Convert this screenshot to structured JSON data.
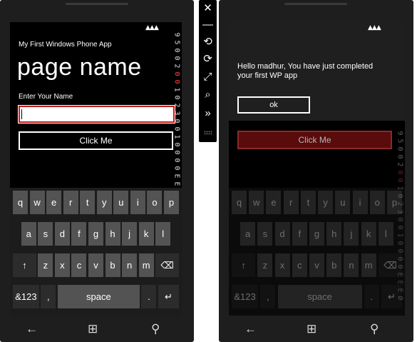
{
  "left_phone": {
    "status": {
      "signal": "▲▲▲"
    },
    "side_counter": [
      "9",
      "5",
      "0",
      "0",
      "2",
      "0",
      "0",
      "1",
      "0",
      "2",
      "3",
      "0",
      "0",
      "1",
      "0",
      "0",
      "0",
      "0",
      "E",
      "E",
      "E",
      "Ø"
    ],
    "app_title": "My First Windows Phone App",
    "page_name": "page name",
    "enter_label": "Enter Your Name",
    "name_value": "",
    "click_button": "Click Me"
  },
  "right_phone": {
    "status": {
      "signal": "▲▲▲"
    },
    "side_counter": [
      "9",
      "5",
      "0",
      "0",
      "2",
      "0",
      "0",
      "1",
      "0",
      "2",
      "3",
      "0",
      "0",
      "1",
      "0",
      "0",
      "0",
      "0",
      "E",
      "E",
      "E",
      "Ø"
    ],
    "message": "Hello madhur, You have just completed your first WP app",
    "ok_button": "ok",
    "click_button": "Click Me"
  },
  "keyboard": {
    "row1": [
      "q",
      "w",
      "e",
      "r",
      "t",
      "y",
      "u",
      "i",
      "o",
      "p"
    ],
    "row2": [
      "a",
      "s",
      "d",
      "f",
      "g",
      "h",
      "j",
      "k",
      "l"
    ],
    "row3": [
      "z",
      "x",
      "c",
      "v",
      "b",
      "n",
      "m"
    ],
    "shift": "↑",
    "backspace": "⌫",
    "symbols": "&123",
    "comma": ",",
    "space": "space",
    "period": ".",
    "enter": "↵"
  },
  "navbar": {
    "back": "←",
    "start": "⊞",
    "search": "⚲"
  },
  "toolbar": {
    "close": "✕",
    "minimize": "—",
    "rotate_left": "⟲",
    "rotate_right": "⟳",
    "fit": "⤢",
    "zoom": "⌕",
    "more": "»"
  }
}
